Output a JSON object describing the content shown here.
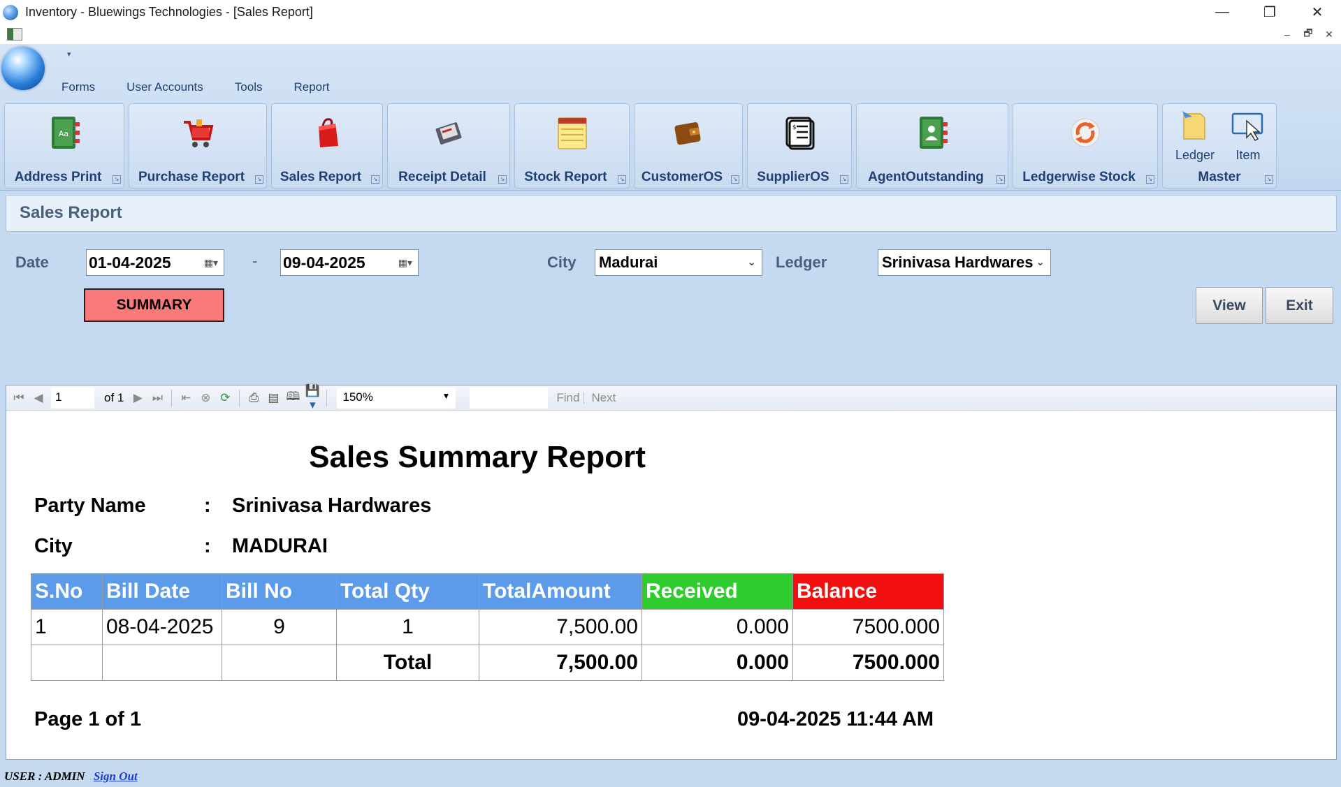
{
  "window": {
    "title": "Inventory - Bluewings Technologies - [Sales Report]",
    "minimize": "—",
    "restore": "❐",
    "close": "✕"
  },
  "mdi": {
    "minimize": "–",
    "restore": "🗗",
    "close": "✕"
  },
  "ribbon": {
    "tabs": [
      "Forms",
      "User Accounts",
      "Tools",
      "Report"
    ],
    "groups": [
      {
        "label": "Address Print",
        "icon": "address-book-icon"
      },
      {
        "label": "Purchase Report",
        "icon": "shopping-cart-icon"
      },
      {
        "label": "Sales Report",
        "icon": "shopping-bag-icon"
      },
      {
        "label": "Receipt Detail",
        "icon": "receipt-icon"
      },
      {
        "label": "Stock Report",
        "icon": "notepad-icon"
      },
      {
        "label": "CustomerOS",
        "icon": "wallet-icon"
      },
      {
        "label": "SupplierOS",
        "icon": "document-list-icon"
      },
      {
        "label": "AgentOutstanding",
        "icon": "contact-book-icon"
      },
      {
        "label": "Ledgerwise Stock",
        "icon": "refresh-arrows-icon"
      }
    ],
    "master": {
      "label": "Master",
      "ledger": "Ledger",
      "item": "Item"
    }
  },
  "form": {
    "title": "Sales Report",
    "date_label": "Date",
    "date_from": "01-04-2025",
    "date_sep": "-",
    "date_to": "09-04-2025",
    "city_label": "City",
    "city_value": "Madurai",
    "ledger_label": "Ledger",
    "ledger_value": "Srinivasa Hardwares",
    "summary_button": "SUMMARY",
    "view_button": "View",
    "exit_button": "Exit"
  },
  "viewer_toolbar": {
    "page_current": "1",
    "page_of": "of 1",
    "zoom": "150%",
    "find": "Find",
    "next": "Next"
  },
  "report": {
    "title": "Sales Summary Report",
    "party_label": "Party Name",
    "party_value": "Srinivasa Hardwares",
    "city_label": "City",
    "city_value": "MADURAI",
    "colon": ":",
    "columns": [
      "S.No",
      "Bill Date",
      "Bill No",
      "Total Qty",
      "TotalAmount",
      "Received",
      "Balance"
    ],
    "rows": [
      {
        "sno": "1",
        "bill_date": "08-04-2025",
        "bill_no": "9",
        "total_qty": "1",
        "total_amount": "7,500.00",
        "received": "0.000",
        "balance": "7500.000"
      }
    ],
    "total": {
      "label": "Total",
      "total_amount": "7,500.00",
      "received": "0.000",
      "balance": "7500.000"
    },
    "page_info": "Page 1 of 1",
    "printed_at": "09-04-2025 11:44 AM"
  },
  "status": {
    "user_label": "USER :",
    "user": "ADMIN",
    "sign_out": "Sign Out"
  }
}
